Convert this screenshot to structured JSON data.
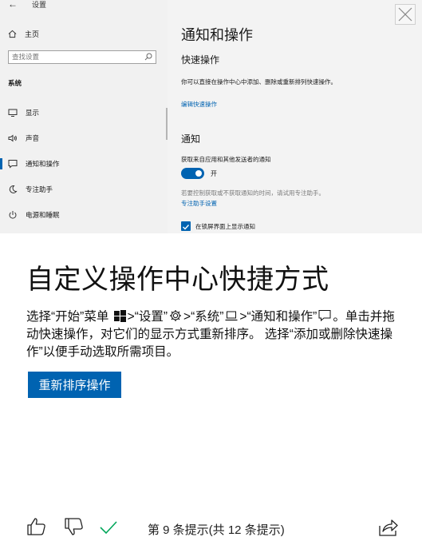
{
  "screenshot": {
    "sidebar": {
      "title": "设置",
      "home": "主页",
      "search_placeholder": "查找设置",
      "section": "系统",
      "items": [
        {
          "label": "显示",
          "icon": "monitor-icon"
        },
        {
          "label": "声音",
          "icon": "speaker-icon"
        },
        {
          "label": "通知和操作",
          "icon": "notification-icon",
          "selected": true
        },
        {
          "label": "专注助手",
          "icon": "moon-icon"
        },
        {
          "label": "电源和睡眠",
          "icon": "power-icon"
        }
      ]
    },
    "main": {
      "heading": "通知和操作",
      "quick_actions": "快速操作",
      "quick_desc": "你可以直接在操作中心中添加、删除或重新排列快速操作。",
      "edit_link": "编辑快速操作",
      "notifications": "通知",
      "get_notifications": "获取来自应用和其他发送者的通知",
      "toggle_label": "开",
      "toggle_on": true,
      "hint": "若要控制获取或不获取通知的时间，请试用专注助手。",
      "focus_link": "专注助手设置",
      "checkbox_label": "在锁屏界面上显示通知",
      "checkbox_checked": true
    }
  },
  "tip": {
    "title": "自定义操作中心快捷方式",
    "body": {
      "p1": "选择“开始”菜单",
      "p2": ">“设置”",
      "p3": ">“系统”",
      "p4": ">“通知和操作”",
      "p5": "。单击并拖动快速操作，对它们的显示方式重新排序。 选择“添加或删除快速操作”以便手动选取所需项目。"
    },
    "action_button": "重新排序操作"
  },
  "footer": {
    "counter": "第 9 条提示(共 12 条提示)"
  },
  "colors": {
    "accent": "#0063b1",
    "done_check": "#00a65a"
  }
}
